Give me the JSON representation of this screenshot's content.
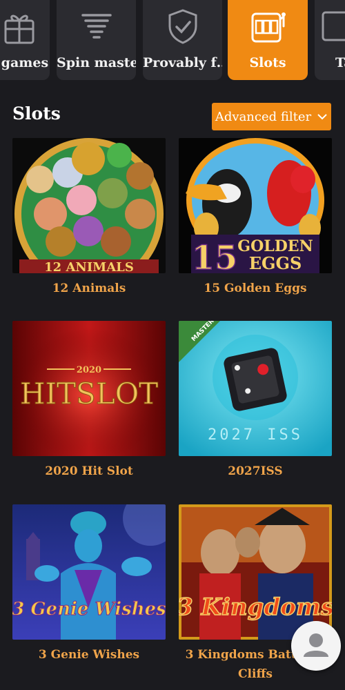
{
  "categories": [
    {
      "label": "y games",
      "icon": "gift-icon"
    },
    {
      "label": "Spin maste…",
      "icon": "tornado-icon"
    },
    {
      "label": "Provably f…",
      "icon": "shield-check-icon"
    },
    {
      "label": "Slots",
      "icon": "slot-machine-icon",
      "active": true
    },
    {
      "label": "Ta",
      "icon": "table-icon"
    }
  ],
  "section": {
    "title": "Slots",
    "filter_label": "Advanced filter"
  },
  "games": [
    {
      "title": "12 Animals",
      "badge": "12 ANIMALS"
    },
    {
      "title": "15 Golden Eggs",
      "badge_num": "15",
      "badge_line1": "GOLDEN",
      "badge_line2": "EGGS"
    },
    {
      "title": "2020 Hit Slot",
      "year": "2020",
      "logo": "HITSLOT"
    },
    {
      "title": "2027ISS",
      "corner": "MASTERS",
      "code": "2027 ISS"
    },
    {
      "title": "3 Genie Wishes",
      "logo": "3 Genie Wishes"
    },
    {
      "title": "3 Kingdoms Battle of",
      "title_line2": "Cliffs",
      "logo": "3 Kingdoms"
    }
  ],
  "colors": {
    "accent": "#f08a13",
    "title": "#f0a44a",
    "background": "#1b1b1f"
  }
}
